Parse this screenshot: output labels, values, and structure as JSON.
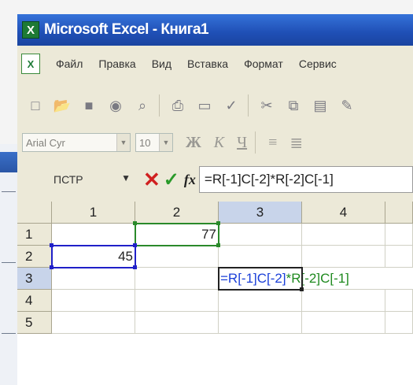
{
  "window": {
    "title": "Microsoft Excel - Книга1",
    "app_icon": "excel-icon"
  },
  "menu": {
    "items": [
      "Файл",
      "Правка",
      "Вид",
      "Вставка",
      "Формат",
      "Сервис"
    ]
  },
  "toolbar": {
    "icons": [
      "new-icon",
      "open-icon",
      "save-icon",
      "permission-icon",
      "search-icon",
      "print-icon",
      "preview-icon",
      "spelling-icon",
      "cut-icon",
      "copy-icon",
      "paste-icon",
      "format-painter-icon"
    ]
  },
  "format_bar": {
    "font_name": "Arial Cyr",
    "font_size": "10",
    "bold": "Ж",
    "italic": "К",
    "underline": "Ч"
  },
  "formula_bar": {
    "name_box": "ПСТР",
    "cancel_symbol": "✕",
    "enter_symbol": "✓",
    "fx_label": "fx",
    "formula": "=R[-1]C[-2]*R[-2]C[-1]"
  },
  "sheet": {
    "column_headers": [
      "1",
      "2",
      "3",
      "4"
    ],
    "row_headers": [
      "1",
      "2",
      "3",
      "4",
      "5"
    ],
    "cells": {
      "r1c2": "77",
      "r2c1": "45",
      "r3c3_part1": "=R[-1]C[-2]",
      "r3c3_part2": "*R[-2]C[-1]"
    },
    "colors": {
      "ref1": "#1a3fd8",
      "ref2": "#1f8a1f",
      "selected_header": "#c8d4ea"
    }
  }
}
